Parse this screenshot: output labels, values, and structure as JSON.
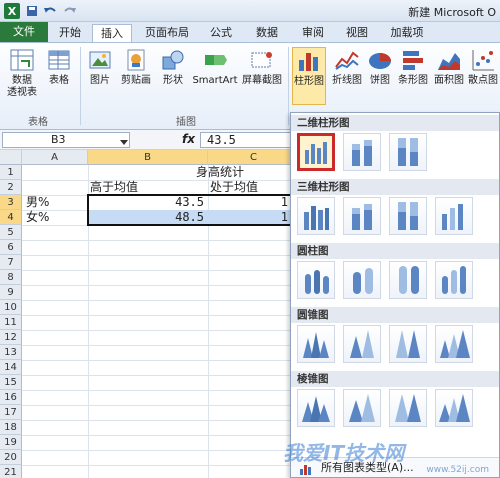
{
  "window": {
    "title": "新建 Microsoft O"
  },
  "quick_access": [
    "save-icon",
    "undo-icon",
    "redo-icon"
  ],
  "tabs": [
    {
      "label": "文件"
    },
    {
      "label": "开始"
    },
    {
      "label": "插入"
    },
    {
      "label": "页面布局"
    },
    {
      "label": "公式"
    },
    {
      "label": "数据"
    },
    {
      "label": "审阅"
    },
    {
      "label": "视图"
    },
    {
      "label": "加载项"
    }
  ],
  "ribbon": {
    "groups": [
      {
        "label": "表格",
        "buttons": [
          {
            "label": "数据\n透视表"
          },
          {
            "label": "表格"
          }
        ]
      },
      {
        "label": "插图",
        "buttons": [
          {
            "label": "图片"
          },
          {
            "label": "剪贴画"
          },
          {
            "label": "形状"
          },
          {
            "label": "SmartArt"
          },
          {
            "label": "屏幕截图"
          }
        ]
      },
      {
        "label": "",
        "buttons": [
          {
            "label": "柱形图"
          },
          {
            "label": "折线图"
          },
          {
            "label": "饼图"
          },
          {
            "label": "条形图"
          },
          {
            "label": "面积图"
          },
          {
            "label": "散点图"
          }
        ]
      }
    ]
  },
  "formula_bar": {
    "name_box": "B3",
    "fx": "fx",
    "formula": "43.5"
  },
  "sheet": {
    "columns": [
      "A",
      "B",
      "C"
    ],
    "rows": [
      "1",
      "2",
      "3",
      "4",
      "5",
      "6",
      "7",
      "8",
      "9",
      "10",
      "11",
      "12",
      "13",
      "14",
      "15",
      "16",
      "17",
      "18",
      "19",
      "20",
      "21"
    ],
    "cells": {
      "title": "身高统计",
      "b2": "高于均值",
      "c2": "处于均值",
      "a3": "男%",
      "a4": "女%",
      "b3": "43.5",
      "b4": "48.5",
      "c3": "1",
      "c4": "1"
    }
  },
  "gallery": {
    "sections": [
      {
        "label": "二维柱形图"
      },
      {
        "label": "三维柱形图"
      },
      {
        "label": "圆柱图"
      },
      {
        "label": "圆锥图"
      },
      {
        "label": "棱锥图"
      }
    ],
    "all_types": "所有图表类型(A)..."
  },
  "watermark": {
    "text": "我爱IT技术网",
    "url": "www.52ij.com"
  },
  "colors": {
    "file_tab": "#2a7a3c",
    "selection": "#c6dcf5",
    "selected_border": "#cc2a2a"
  }
}
